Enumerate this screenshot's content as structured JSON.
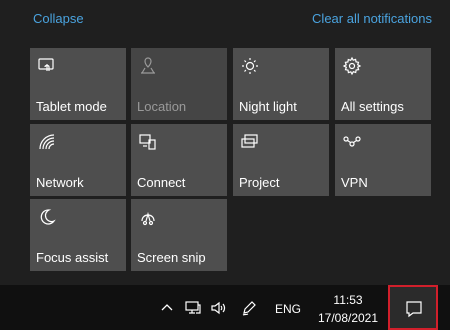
{
  "header": {
    "collapse_label": "Collapse",
    "clear_label": "Clear all notifications"
  },
  "tiles": [
    {
      "label": "Tablet mode",
      "icon": "tablet-mode-icon",
      "enabled": true
    },
    {
      "label": "Location",
      "icon": "location-icon",
      "enabled": false
    },
    {
      "label": "Night light",
      "icon": "night-light-icon",
      "enabled": true
    },
    {
      "label": "All settings",
      "icon": "settings-gear-icon",
      "enabled": true
    },
    {
      "label": "Network",
      "icon": "network-icon",
      "enabled": true
    },
    {
      "label": "Connect",
      "icon": "connect-icon",
      "enabled": true
    },
    {
      "label": "Project",
      "icon": "project-icon",
      "enabled": true
    },
    {
      "label": "VPN",
      "icon": "vpn-icon",
      "enabled": true
    },
    {
      "label": "Focus assist",
      "icon": "focus-assist-icon",
      "enabled": true
    },
    {
      "label": "Screen snip",
      "icon": "screen-snip-icon",
      "enabled": true
    }
  ],
  "taskbar": {
    "language": "ENG",
    "time": "11:53",
    "date": "17/08/2021",
    "icons": [
      "show-hidden-icons-icon",
      "network-icon",
      "volume-icon",
      "pen-icon"
    ]
  },
  "colors": {
    "accent_link": "#4aa3df",
    "tile_bg": "#4e4e4e",
    "highlight_border": "#d11f2b"
  }
}
